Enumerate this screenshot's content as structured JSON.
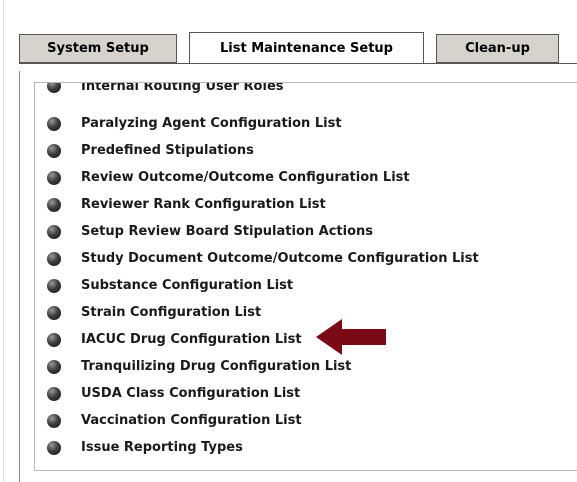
{
  "tabs": [
    {
      "label": "System Setup",
      "active": false
    },
    {
      "label": "List Maintenance Setup",
      "active": true
    },
    {
      "label": "Clean-up",
      "active": false
    }
  ],
  "list": {
    "items": [
      "Internal Routing User Roles",
      "Paralyzing Agent Configuration List",
      "Predefined Stipulations",
      "Review Outcome/Outcome Configuration List",
      "Reviewer Rank Configuration List",
      "Setup Review Board Stipulation Actions",
      "Study Document Outcome/Outcome Configuration List",
      "Substance Configuration List",
      "Strain Configuration List",
      "IACUC Drug Configuration List",
      "Tranquilizing Drug Configuration List",
      "USDA Class Configuration List",
      "Vaccination Configuration List",
      "Issue Reporting Types"
    ]
  },
  "annotation": {
    "arrow_color": "#7a0a16",
    "arrow_icon": "left-arrow-icon"
  }
}
